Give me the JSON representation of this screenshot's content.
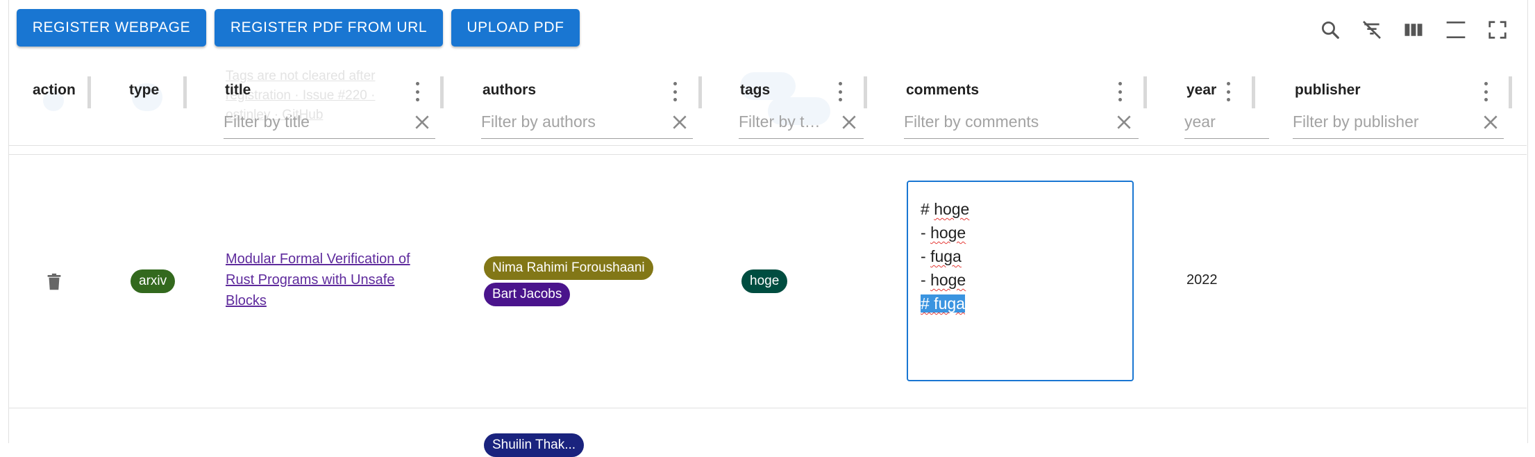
{
  "toolbar": {
    "register_webpage": "REGISTER WEBPAGE",
    "register_pdf_url": "REGISTER PDF FROM URL",
    "upload_pdf": "UPLOAD PDF",
    "icons": [
      "search-icon",
      "filter-off-icon",
      "columns-icon",
      "density-icon",
      "fullscreen-icon"
    ]
  },
  "ghost_row": {
    "title_lines": [
      "Tags are not cleared after",
      "registration · Issue #220 ·",
      "            ostinley · GitHub"
    ]
  },
  "columns": {
    "action": "action",
    "type": "type",
    "title": "title",
    "authors": "authors",
    "tags": "tags",
    "comments": "comments",
    "year": "year",
    "publisher": "publisher"
  },
  "filters": {
    "title": "Filter by title",
    "authors": "Filter by authors",
    "tags": "Filter by t…",
    "comments": "Filter by comments",
    "year": "year",
    "publisher": "Filter by publisher"
  },
  "row": {
    "type": "arxiv",
    "title_lines": [
      "Modular Formal Verification of",
      "Rust Programs with Unsafe",
      "Blocks"
    ],
    "authors": [
      "Nima Rahimi Foroushaani",
      "Bart Jacobs"
    ],
    "tags": [
      "hoge"
    ],
    "comments": {
      "line1_prefix": "# ",
      "line1_word": "hoge",
      "line2_prefix": "- ",
      "line2_word": "hoge",
      "line3_prefix": "- ",
      "line3_word": "fuga",
      "line4_prefix": "- ",
      "line4_word": "hoge",
      "line5_selected": "# fuga"
    },
    "year": "2022",
    "publisher": ""
  },
  "next_row": {
    "author_partial": "Shuilin Thak..."
  },
  "colors": {
    "primary": "#1976d2",
    "arxiv_chip": "#33691e",
    "author1_chip": "#827717",
    "author2_chip": "#4a148c",
    "tag_chip": "#004d40",
    "next_author_chip": "#1a237e"
  }
}
